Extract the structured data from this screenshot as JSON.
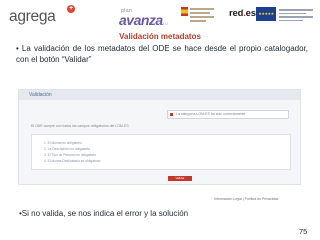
{
  "header": {
    "agrega_text": "agrega",
    "avanza_top": "plan",
    "avanza_word": "avanza",
    "avanza_year": "2.0",
    "redes_name": "red",
    "redes_suffix": "es"
  },
  "slide": {
    "title": "Validación metadatos",
    "intro": "• La validación de los metadatos del ODE se hace desde el propio catalogador, con el botón “Validar”",
    "bullet": "•Si no valida, se nos indica el error y la solución",
    "page_number": "75"
  },
  "screenshot": {
    "panel_title": "Validación",
    "notice": "La categoría LOM-ES ha sido correctamente",
    "description": "El ODE cumple con todos los campos obligatorios del LOM-ES",
    "rows": [
      "1. El Idioma es obligatorio",
      "2. La Descripción es obligatoria",
      "3. El Tipo de Recurso es obligatorio",
      "4. El Idioma Destinatario es obligatorio"
    ],
    "button": "Validar",
    "footer": "Información Legal  |  Política de Privacidad"
  },
  "colors": {
    "title": "#b3412f",
    "accent_red": "#c0392b",
    "panel_bg": "#f4f6f8"
  }
}
